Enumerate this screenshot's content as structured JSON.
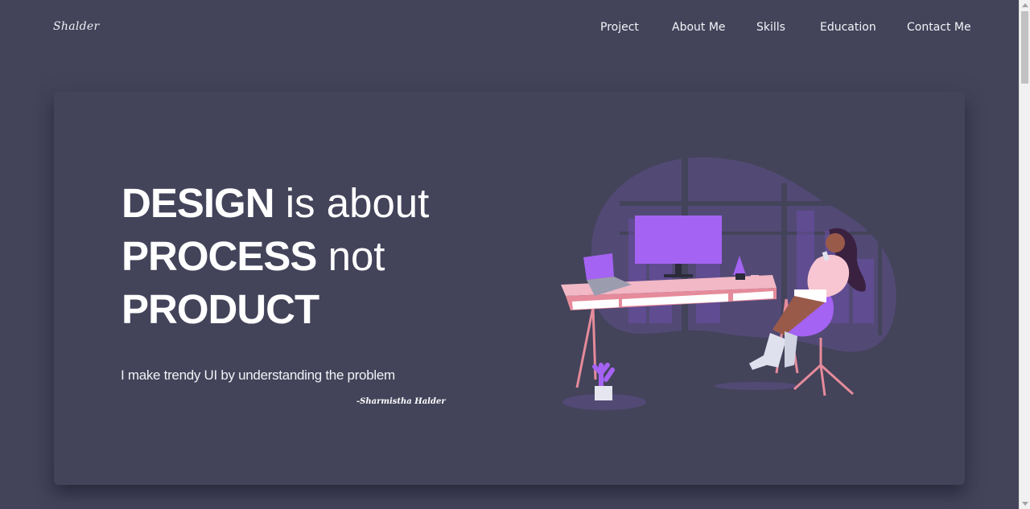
{
  "header": {
    "logo": "Shalder",
    "nav": [
      {
        "label": "Project"
      },
      {
        "label": "About Me"
      },
      {
        "label": "Skills"
      },
      {
        "label": "Education"
      },
      {
        "label": "Contact Me"
      }
    ]
  },
  "hero": {
    "line1_bold": "DESIGN",
    "line1_rest": " is about",
    "line2_bold": "PROCESS",
    "line2_rest": " not",
    "line3_bold": "PRODUCT",
    "tagline": "I make trendy UI by understanding the problem",
    "signature": "-Sharmistha Halder",
    "illustration": "woman-at-desk-illustration"
  },
  "colors": {
    "background": "#43435a",
    "accent_purple": "#a463f2",
    "desk_pink": "#f2b8c6"
  }
}
